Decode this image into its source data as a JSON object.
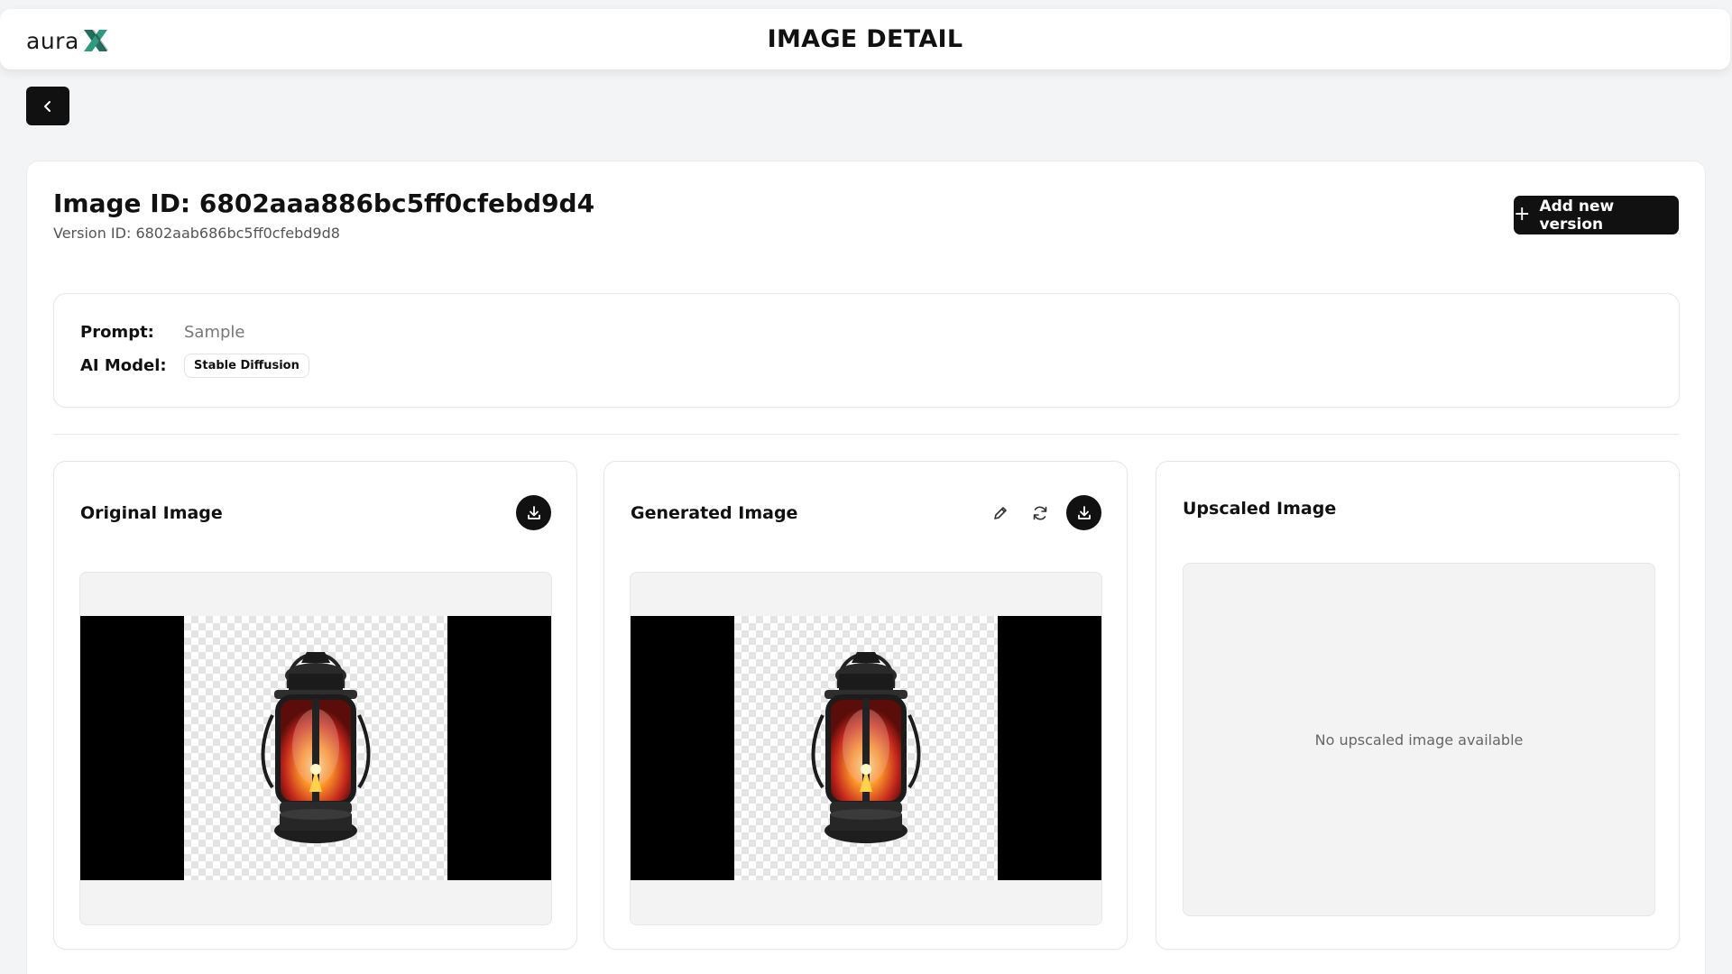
{
  "app": {
    "logo_text": "aura",
    "logo_mark": "X",
    "accent_color": "#1f6f5c"
  },
  "header": {
    "title": "IMAGE DETAIL"
  },
  "nav": {
    "back_icon": "chevron-left-icon"
  },
  "detail": {
    "image_id_label": "Image ID: 6802aaa886bc5ff0cfebd9d4",
    "version_id_label": "Version ID: 6802aab686bc5ff0cfebd9d8",
    "add_version_label": "Add new version"
  },
  "info": {
    "prompt_label": "Prompt:",
    "prompt_value": "Sample",
    "model_label": "AI Model:",
    "model_value": "Stable Diffusion"
  },
  "cards": {
    "original": {
      "title": "Original Image",
      "icons": [
        "download-icon"
      ]
    },
    "generated": {
      "title": "Generated Image",
      "icons": [
        "pencil-icon",
        "refresh-icon",
        "download-icon"
      ]
    },
    "upscaled": {
      "title": "Upscaled Image",
      "empty_text": "No upscaled image available"
    }
  }
}
